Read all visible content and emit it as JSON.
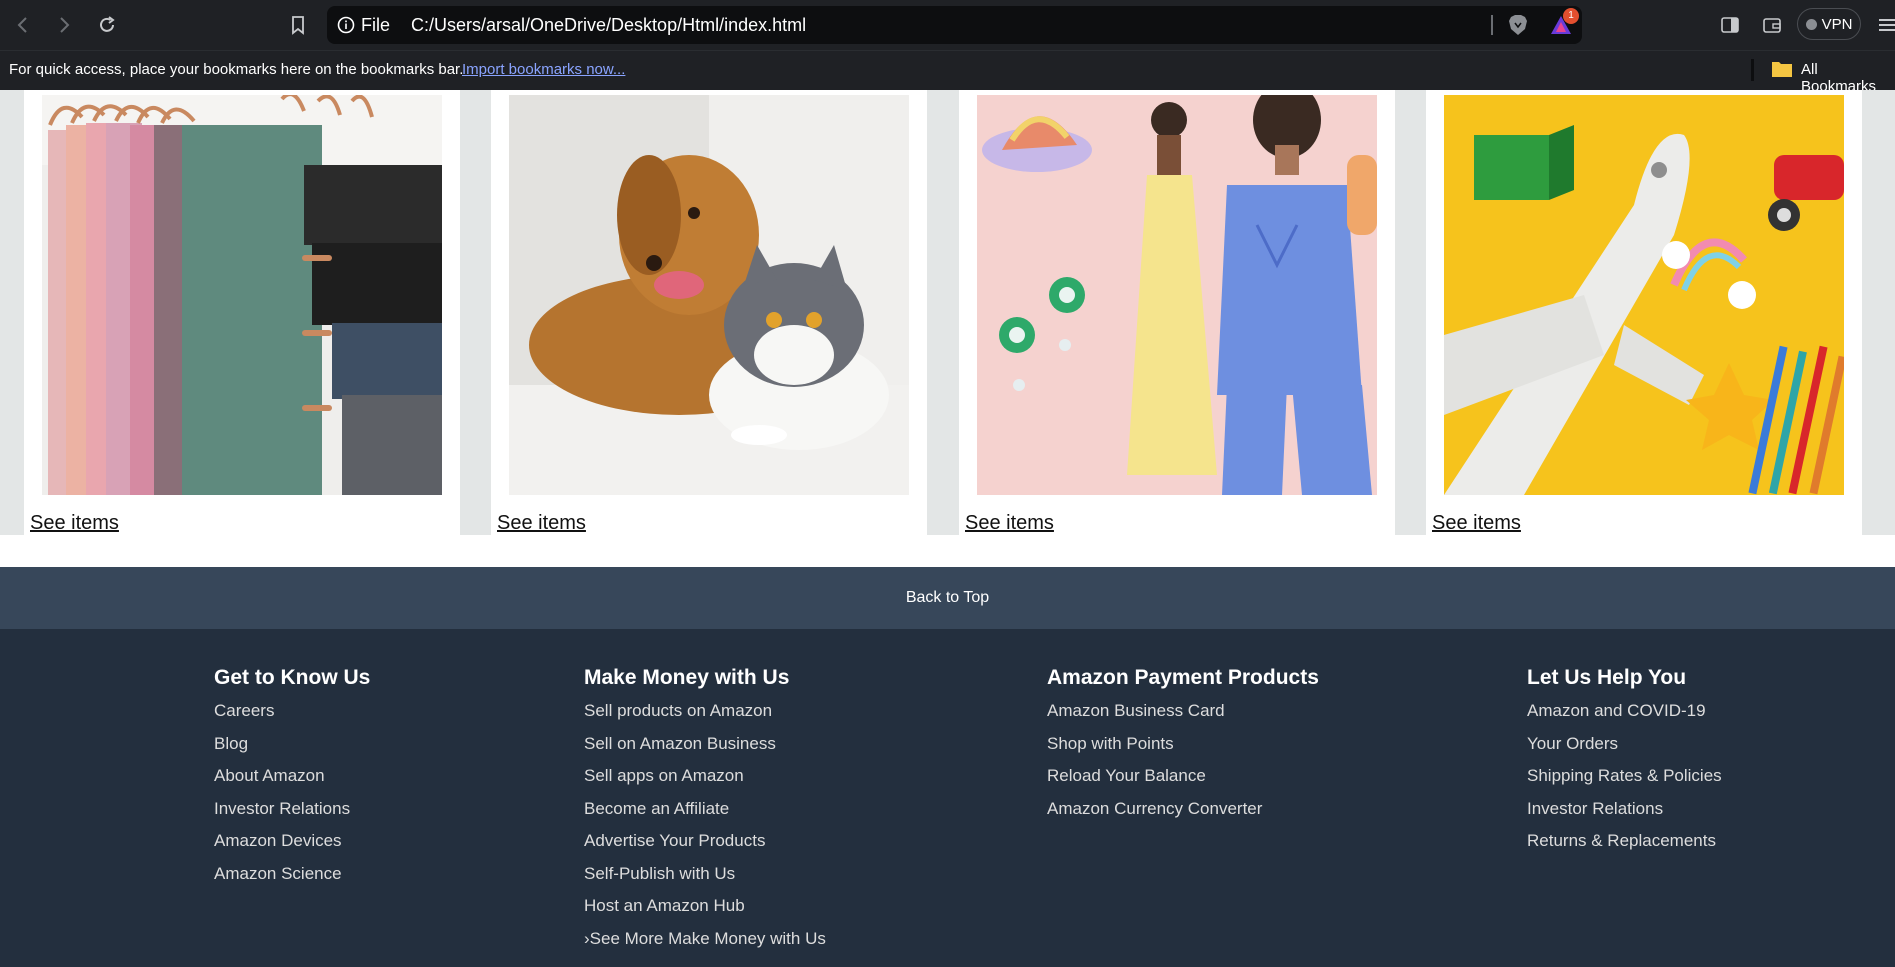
{
  "browser": {
    "file_label": "File",
    "url": "C:/Users/arsal/OneDrive/Desktop/Html/index.html",
    "rewards_badge": "1",
    "vpn_label": "VPN"
  },
  "bookmarks_bar": {
    "message": "For quick access, place your bookmarks here on the bookmarks bar.",
    "import_link": "Import bookmarks now...",
    "all_bookmarks": "All Bookmarks"
  },
  "cards": [
    {
      "link": "See items",
      "image": "hangers-fabrics"
    },
    {
      "link": "See items",
      "image": "dog-and-cat"
    },
    {
      "link": "See items",
      "image": "fashion-models"
    },
    {
      "link": "See items",
      "image": "toys-airplane"
    }
  ],
  "back_to_top": "Back to Top",
  "footer": {
    "columns": [
      {
        "title": "Get to Know Us",
        "links": [
          "Careers",
          "Blog",
          "About Amazon",
          "Investor Relations",
          "Amazon Devices",
          "Amazon Science"
        ]
      },
      {
        "title": "Make Money with Us",
        "links": [
          "Sell products on Amazon",
          "Sell on Amazon Business",
          "Sell apps on Amazon",
          "Become an Affiliate",
          "Advertise Your Products",
          "Self-Publish with Us",
          "Host an Amazon Hub",
          "›See More Make Money with Us"
        ]
      },
      {
        "title": "Amazon Payment Products",
        "links": [
          "Amazon Business Card",
          "Shop with Points",
          "Reload Your Balance",
          "Amazon Currency Converter"
        ]
      },
      {
        "title": "Let Us Help You",
        "links": [
          "Amazon and COVID-19",
          "Your Orders",
          "Shipping Rates & Policies",
          "Investor Relations",
          "Returns & Replacements"
        ]
      }
    ]
  },
  "colors": {
    "browser_chrome": "#1f2125",
    "back_to_top_bg": "#37475a",
    "footer_bg": "#232f3e",
    "page_bg": "#e3e6e6"
  }
}
